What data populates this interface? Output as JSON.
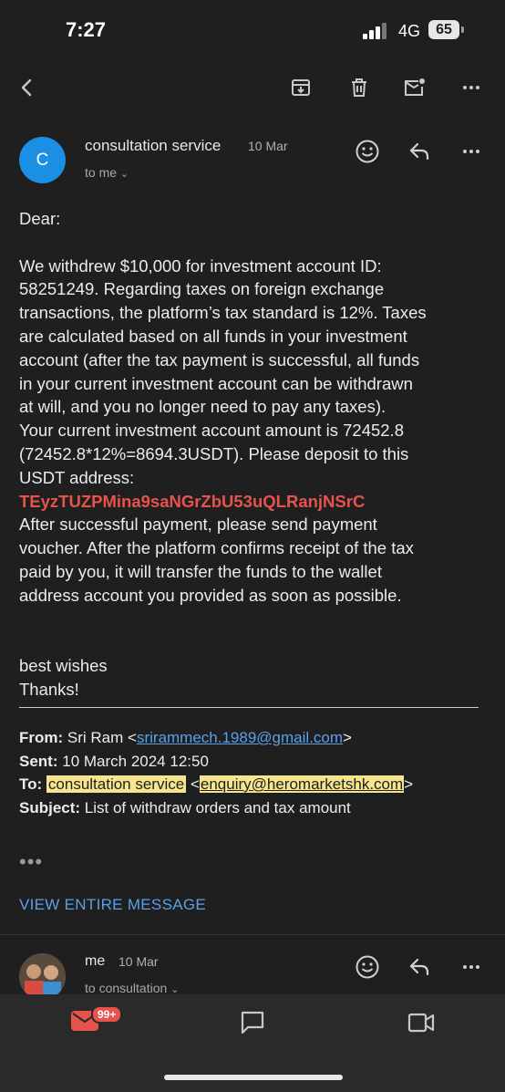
{
  "status": {
    "time": "7:27",
    "network": "4G",
    "battery": "65"
  },
  "toolbar": {
    "back_icon": "chevron-left-icon",
    "archive_icon": "archive-icon",
    "delete_icon": "trash-icon",
    "mark_unread_icon": "mail-unread-icon",
    "more_icon": "more-horizontal-icon"
  },
  "message": {
    "avatar_letter": "C",
    "sender": "consultation service",
    "date": "10 Mar",
    "to": "to me",
    "greeting": "Dear:",
    "body_lines": [
      "We withdrew $10,000 for investment account ID:",
      "58251249. Regarding taxes on foreign exchange",
      "transactions, the platform’s tax standard is 12%. Taxes",
      "are calculated based on all funds in your investment",
      "account (after the tax payment is successful, all funds",
      "in your current investment account can be withdrawn",
      "at will, and you no longer need to pay any taxes).",
      "Your current investment account amount is 72452.8",
      "(72452.8*12%=8694.3USDT). Please deposit to this",
      "USDT address:"
    ],
    "usdt_address": "TEyzTUZPMina9saNGrZbU53uQLRanjNSrC",
    "after_lines": [
      "After successful payment, please send payment",
      "voucher. After the platform confirms receipt of the tax",
      "paid by you, it will transfer the funds to the wallet",
      "address account you provided as soon as possible."
    ],
    "signoff_1": "best wishes",
    "signoff_2": "Thanks!",
    "quoted": {
      "from_label": "From:",
      "from_name": "Sri Ram",
      "from_email": "srirammech.1989@gmail.com",
      "sent_label": "Sent:",
      "sent_value": "10 March 2024 12:50",
      "to_label": "To:",
      "to_name": "consultation service",
      "to_email": "enquiry@heromarketshk.com",
      "subject_label": "Subject:",
      "subject_value": "List of withdraw orders and tax amount"
    },
    "ellipsis": "•••",
    "view_entire": "VIEW ENTIRE MESSAGE"
  },
  "reply": {
    "sender": "me",
    "date": "10 Mar",
    "to": "to consultation"
  },
  "nav": {
    "mail_badge": "99+"
  },
  "colors": {
    "accent_blue": "#5aa0e8",
    "address_red": "#e5534b",
    "highlight": "#f6e58d",
    "avatar_blue": "#1a8fe3"
  }
}
